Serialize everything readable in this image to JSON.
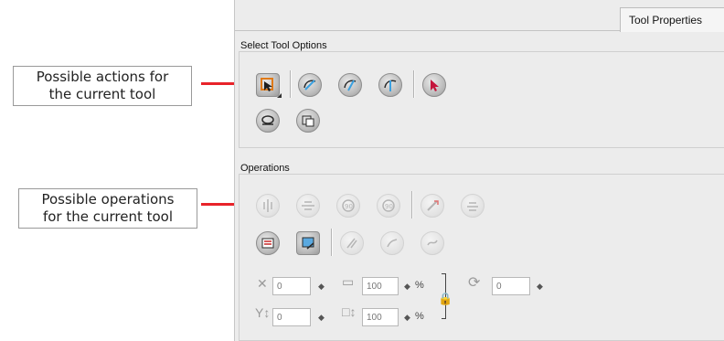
{
  "callouts": {
    "actions": [
      "Possible actions for",
      "the current tool"
    ],
    "operations": [
      "Possible operations",
      "for the current tool"
    ]
  },
  "tab": {
    "label": "Tool Properties"
  },
  "select_tool_options": {
    "title": "Select Tool Options",
    "icons": [
      "select-mode-icon",
      "lasso-select-icon",
      "marquee-select-icon",
      "select-by-color-icon",
      "selection-arrow-icon",
      "snap-to-contour-icon",
      "sub-select-icon"
    ]
  },
  "operations": {
    "title": "Operations",
    "icons": [
      "flip-horizontal-icon",
      "flip-vertical-icon",
      "rotate-ccw-icon",
      "rotate-cw-icon",
      "smooth-icon",
      "optimize-icon",
      "create-colour-art-icon",
      "flatten-icon",
      "cutter-icon",
      "pencil-to-brush-icon",
      "brush-to-pencil-icon"
    ],
    "fields": {
      "x": "0",
      "y": "0",
      "width": "100",
      "height": "100",
      "angle": "0",
      "percent": "%"
    }
  },
  "colors": {
    "accent": "#e8232a",
    "panel_bg": "#ececec"
  }
}
